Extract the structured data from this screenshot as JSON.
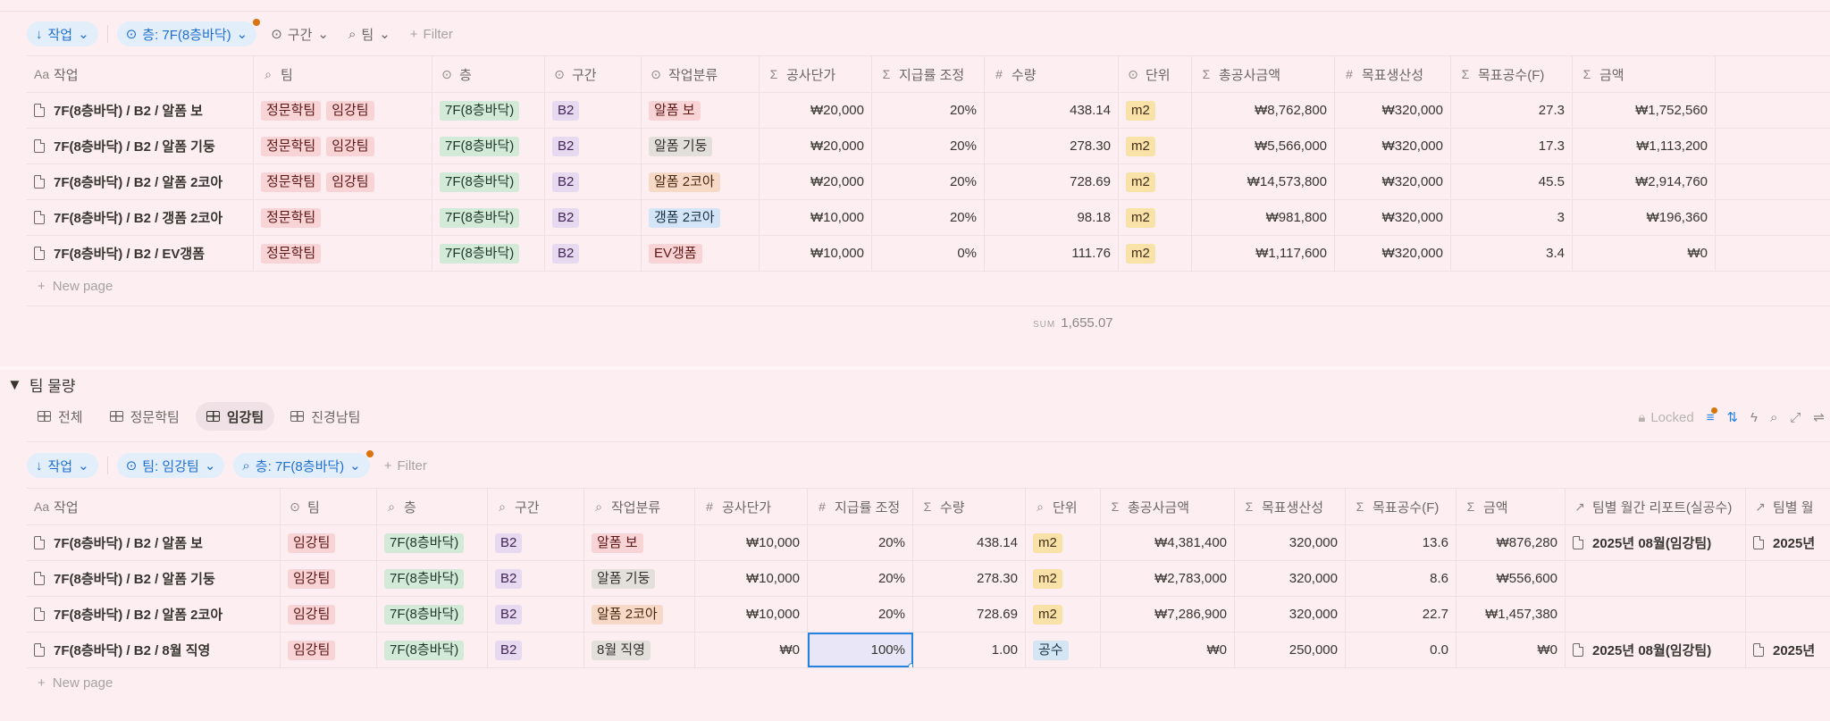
{
  "top": {
    "filters": {
      "sort": "작업",
      "floor": "층: 7F(8층바닥)",
      "section": "구간",
      "team": "팀",
      "filter": "Filter"
    },
    "columns": [
      "작업",
      "팀",
      "층",
      "구간",
      "작업분류",
      "공사단가",
      "지급률 조정",
      "수량",
      "단위",
      "총공사금액",
      "목표생산성",
      "목표공수(F)",
      "금액"
    ],
    "rows": [
      {
        "task": "7F(8층바닥) / B2 / 알폼 보",
        "teams": [
          "정문학팀",
          "임강팀"
        ],
        "floor": "7F(8층바닥)",
        "section": "B2",
        "category": "알폼 보",
        "cat_color": "red",
        "price": "₩20,000",
        "rate": "20%",
        "qty": "438.14",
        "unit": "m2",
        "total": "₩8,762,800",
        "productivity": "₩320,000",
        "manhours": "27.3",
        "amount": "₩1,752,560"
      },
      {
        "task": "7F(8층바닥) / B2 / 알폼 기둥",
        "teams": [
          "정문학팀",
          "임강팀"
        ],
        "floor": "7F(8층바닥)",
        "section": "B2",
        "category": "알폼 기둥",
        "cat_color": "gray",
        "price": "₩20,000",
        "rate": "20%",
        "qty": "278.30",
        "unit": "m2",
        "total": "₩5,566,000",
        "productivity": "₩320,000",
        "manhours": "17.3",
        "amount": "₩1,113,200"
      },
      {
        "task": "7F(8층바닥) / B2 / 알폼 2코아",
        "teams": [
          "정문학팀",
          "임강팀"
        ],
        "floor": "7F(8층바닥)",
        "section": "B2",
        "category": "알폼 2코아",
        "cat_color": "orange",
        "price": "₩20,000",
        "rate": "20%",
        "qty": "728.69",
        "unit": "m2",
        "total": "₩14,573,800",
        "productivity": "₩320,000",
        "manhours": "45.5",
        "amount": "₩2,914,760"
      },
      {
        "task": "7F(8층바닥) / B2 / 갱폼 2코아",
        "teams": [
          "정문학팀"
        ],
        "floor": "7F(8층바닥)",
        "section": "B2",
        "category": "갱폼 2코아",
        "cat_color": "blue",
        "price": "₩10,000",
        "rate": "20%",
        "qty": "98.18",
        "unit": "m2",
        "total": "₩981,800",
        "productivity": "₩320,000",
        "manhours": "3",
        "amount": "₩196,360"
      },
      {
        "task": "7F(8층바닥) / B2 / EV갱폼",
        "teams": [
          "정문학팀"
        ],
        "floor": "7F(8층바닥)",
        "section": "B2",
        "category": "EV갱폼",
        "cat_color": "red",
        "price": "₩10,000",
        "rate": "0%",
        "qty": "111.76",
        "unit": "m2",
        "total": "₩1,117,600",
        "productivity": "₩320,000",
        "manhours": "3.4",
        "amount": "₩0"
      }
    ],
    "new_page": "New page",
    "sum_label": "SUM",
    "sum_value": "1,655.07"
  },
  "section": {
    "title": "팀 물량",
    "tabs": [
      "전체",
      "정문학팀",
      "임강팀",
      "진경남팀"
    ],
    "active_tab": 2,
    "locked": "Locked"
  },
  "bottom": {
    "filters": {
      "sort": "작업",
      "team": "팀: 임강팀",
      "floor": "층: 7F(8층바닥)",
      "filter": "Filter"
    },
    "columns": [
      "작업",
      "팀",
      "층",
      "구간",
      "작업분류",
      "공사단가",
      "지급률 조정",
      "수량",
      "단위",
      "총공사금액",
      "목표생산성",
      "목표공수(F)",
      "금액",
      "팀별 월간 리포트(실공수)",
      "팀별 월"
    ],
    "rows": [
      {
        "task": "7F(8층바닥) / B2 / 알폼 보",
        "team": "임강팀",
        "floor": "7F(8층바닥)",
        "section": "B2",
        "category": "알폼 보",
        "cat_color": "red",
        "price": "₩10,000",
        "rate": "20%",
        "qty": "438.14",
        "unit": "m2",
        "unit_color": "yellow",
        "total": "₩4,381,400",
        "productivity": "320,000",
        "manhours": "13.6",
        "amount": "₩876,280",
        "report": "2025년 08월(임강팀)",
        "report2": "2025년"
      },
      {
        "task": "7F(8층바닥) / B2 / 알폼 기둥",
        "team": "임강팀",
        "floor": "7F(8층바닥)",
        "section": "B2",
        "category": "알폼 기둥",
        "cat_color": "gray",
        "price": "₩10,000",
        "rate": "20%",
        "qty": "278.30",
        "unit": "m2",
        "unit_color": "yellow",
        "total": "₩2,783,000",
        "productivity": "320,000",
        "manhours": "8.6",
        "amount": "₩556,600",
        "report": "",
        "report2": ""
      },
      {
        "task": "7F(8층바닥) / B2 / 알폼 2코아",
        "team": "임강팀",
        "floor": "7F(8층바닥)",
        "section": "B2",
        "category": "알폼 2코아",
        "cat_color": "orange",
        "price": "₩10,000",
        "rate": "20%",
        "qty": "728.69",
        "unit": "m2",
        "unit_color": "yellow",
        "total": "₩7,286,900",
        "productivity": "320,000",
        "manhours": "22.7",
        "amount": "₩1,457,380",
        "report": "",
        "report2": ""
      },
      {
        "task": "7F(8층바닥) / B2 / 8월 직영",
        "team": "임강팀",
        "floor": "7F(8층바닥)",
        "section": "B2",
        "category": "8월 직영",
        "cat_color": "gray",
        "price": "₩0",
        "rate": "100%",
        "qty": "1.00",
        "unit": "공수",
        "unit_color": "sky",
        "total": "₩0",
        "productivity": "250,000",
        "manhours": "0.0",
        "amount": "₩0",
        "report": "2025년 08월(임강팀)",
        "report2": "2025년"
      }
    ],
    "new_page": "New page"
  },
  "icons": {
    "text": "Aa",
    "search": "search-icon",
    "select": "select-icon",
    "sigma": "Σ",
    "hash": "#",
    "relation": "↗"
  },
  "colors": {
    "accent": "#2383e2",
    "background": "#fdeef2",
    "notify": "#d9730d"
  }
}
